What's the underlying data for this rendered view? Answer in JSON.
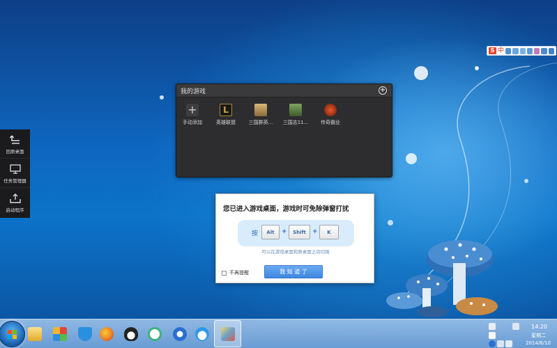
{
  "ime_bar": {
    "logo": "S",
    "mode": "中",
    "icons": [
      "moon-icon",
      "dot-icon",
      "smiley-icon",
      "keyboard-icon",
      "person-icon",
      "shirt-icon",
      "wrench-icon"
    ]
  },
  "my_games": {
    "title": "我的游戏",
    "add_icon": "plus-circle-icon",
    "items": [
      {
        "label": "手动添加",
        "icon": "plus-icon",
        "color": "#4a4a4c"
      },
      {
        "label": "英雄联盟",
        "icon": "lol-icon",
        "color": "#b08a2e"
      },
      {
        "label": "三国群英...",
        "icon": "three-kingdoms-icon",
        "color": "#c7a05a"
      },
      {
        "label": "三国志11...",
        "icon": "sangokushi-icon",
        "color": "#6f8f53"
      },
      {
        "label": "传奇霸业",
        "icon": "legend-icon",
        "color": "#a3351d"
      }
    ]
  },
  "left_dock": {
    "items": [
      {
        "label": "回原桌面",
        "icon": "return-icon"
      },
      {
        "label": "任务管理器",
        "icon": "monitor-icon"
      },
      {
        "label": "启动程序",
        "icon": "upload-icon"
      }
    ]
  },
  "notice": {
    "title": "您已进入游戏桌面，游戏时可免除弹窗打扰",
    "press": "按",
    "keys": [
      "Alt",
      "Shift",
      "K"
    ],
    "plus": "+",
    "hint": "可以在游戏桌面和原桌面之间切换",
    "dont_remind": "不再提醒",
    "ok": "我 知 道 了"
  },
  "taskbar": {
    "apps": [
      {
        "name": "folder",
        "icon": "folder-icon",
        "color": "#f2c55a"
      },
      {
        "name": "app-store",
        "icon": "grid-icon",
        "color": "#e0463a"
      },
      {
        "name": "security",
        "icon": "shield-icon",
        "color": "#2b8fe0"
      },
      {
        "name": "firefox",
        "icon": "firefox-icon",
        "color": "#e8792a"
      },
      {
        "name": "qq",
        "icon": "penguin-icon",
        "color": "#222222"
      },
      {
        "name": "search-app",
        "icon": "magnifier-icon",
        "color": "#3bb37a"
      },
      {
        "name": "player",
        "icon": "player-icon",
        "color": "#2a6fd0"
      },
      {
        "name": "weather",
        "icon": "cloud-icon",
        "color": "#2f9ae6"
      },
      {
        "name": "game-desktop",
        "icon": "game-desktop-icon",
        "color": "#6aa0c8"
      }
    ],
    "tray_icons": [
      "cloud-tray-icon",
      "flag-tray-icon",
      "question-tray-icon",
      "sogou-tray-icon",
      "network-tray-icon",
      "volume-tray-icon"
    ],
    "time": "14:20",
    "weekday": "星期二",
    "date": "2014/6/10"
  }
}
